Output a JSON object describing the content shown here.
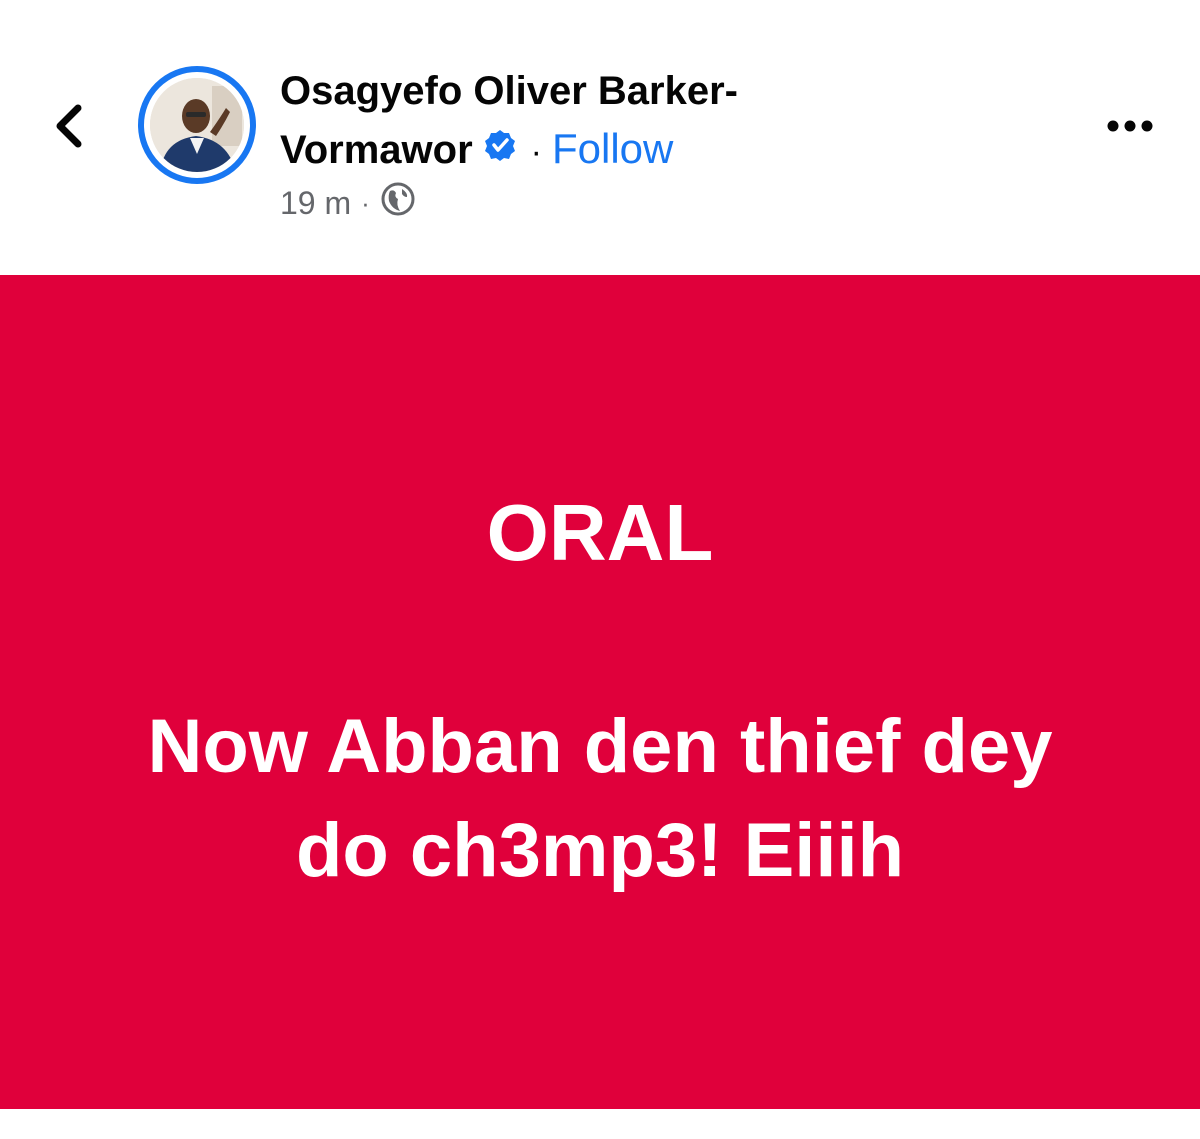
{
  "header": {
    "author_name": "Osagyefo Oliver Barker-Vormawor",
    "separator": "·",
    "follow_label": "Follow",
    "timestamp": "19 m",
    "meta_separator": "·",
    "privacy_icon": "globe-icon",
    "back_icon": "chevron-left-icon",
    "more_icon": "more-horizontal-icon",
    "verified_icon": "verified-badge-icon"
  },
  "post": {
    "title": "ORAL",
    "body": "Now Abban den thief dey do ch3mp3! Eiiih",
    "background_color": "#e0003b",
    "text_color": "#ffffff"
  },
  "colors": {
    "accent": "#1877f2",
    "secondary_text": "#65676b",
    "primary_text": "#050505"
  }
}
